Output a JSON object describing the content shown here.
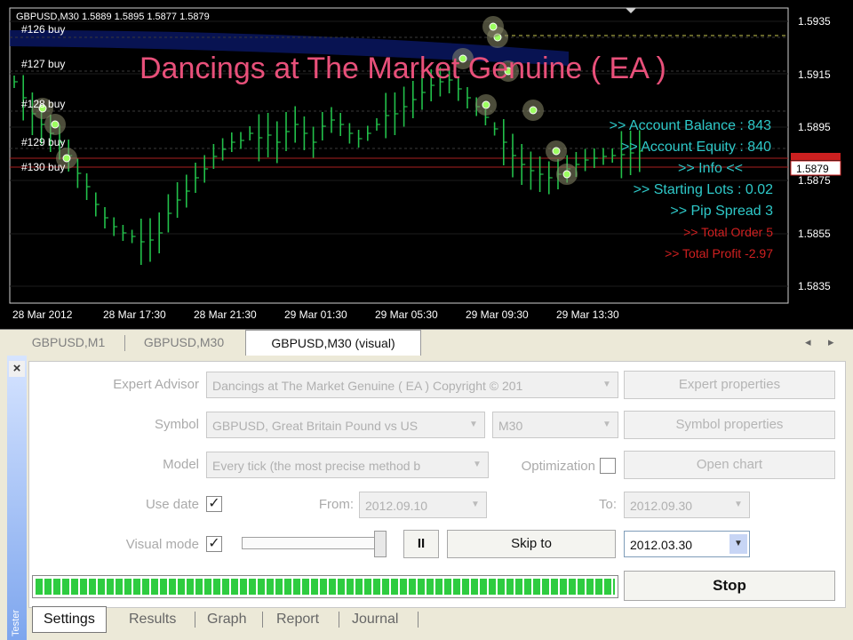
{
  "chart": {
    "header": "GBPUSD,M30  1.5889 1.5895 1.5877 1.5879",
    "title": "Dancings at The Market Genuine ( EA )",
    "order_labels": [
      "#126 buy",
      "#127 buy",
      "#128 buy",
      "#129 buy",
      "#130 buy"
    ],
    "price_ticks": [
      "1.5935",
      "1.5915",
      "1.5895",
      "1.5875",
      "1.5855",
      "1.5835"
    ],
    "current_price": "1.5879",
    "time_ticks": [
      "28 Mar 2012",
      "28 Mar 17:30",
      "28 Mar 21:30",
      "29 Mar 01:30",
      "29 Mar 05:30",
      "29 Mar 09:30",
      "29 Mar 13:30"
    ],
    "info_lines": [
      {
        "text": ">> Account Balance : 843",
        "color": "#2ec9c9"
      },
      {
        "text": ">> Account Equity : 840",
        "color": "#2ec9c9"
      },
      {
        "text": ">> Info <<",
        "color": "#2ec9c9"
      },
      {
        "text": ">> Starting Lots : 0.02",
        "color": "#2ec9c9"
      },
      {
        "text": ">> Pip Spread      3",
        "color": "#2ec9c9"
      },
      {
        "text": ">> Total Order      5",
        "color": "#d02020"
      },
      {
        "text": ">> Total Profit   -2.97",
        "color": "#d02020"
      }
    ],
    "colors": {
      "background": "#000000",
      "candles": "#22c04a",
      "title": "#e8507a",
      "bid_line": "#cc2020"
    }
  },
  "chart_tabs": [
    "GBPUSD,M1",
    "GBPUSD,M30",
    "GBPUSD,M30 (visual)"
  ],
  "tester": {
    "close_glyph": "×",
    "side_label": "Tester",
    "expert_label": "Expert Advisor",
    "expert_value": "Dancings at The Market Genuine ( EA ) Copyright © 201",
    "expert_props": "Expert properties",
    "symbol_label": "Symbol",
    "symbol_value": "GBPUSD, Great Britain Pound vs US",
    "period_value": "M30",
    "symbol_props": "Symbol properties",
    "model_label": "Model",
    "model_value": "Every tick (the most precise method b",
    "optimization_label": "Optimization",
    "open_chart": "Open chart",
    "use_date_label": "Use date",
    "from_label": "From:",
    "from_value": "2012.09.10",
    "to_label": "To:",
    "to_value": "2012.09.30",
    "visual_label": "Visual mode",
    "pause_glyph": "II",
    "skip_label": "Skip to",
    "skip_date": "2012.03.30",
    "stop_label": "Stop",
    "check_glyph": "✓",
    "progress": 1.0
  },
  "bottom_tabs": [
    "Settings",
    "Results",
    "Graph",
    "Report",
    "Journal"
  ]
}
